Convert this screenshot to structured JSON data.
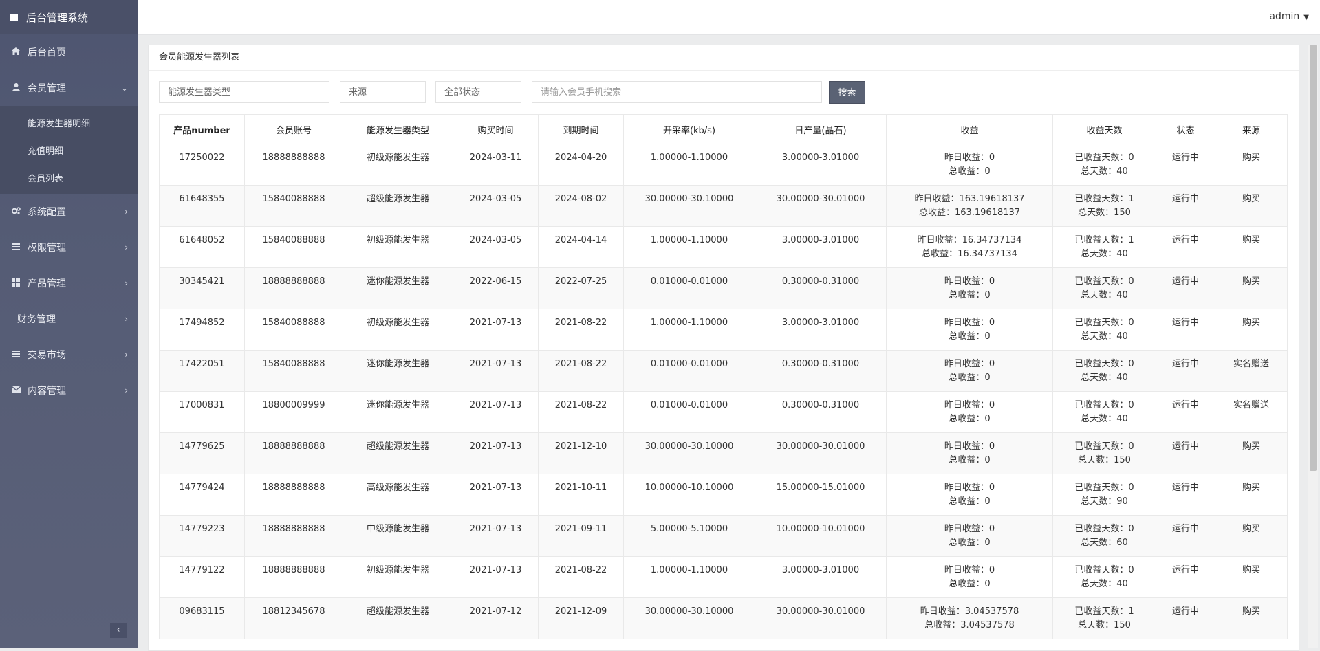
{
  "app": {
    "title": "后台管理系统"
  },
  "topbar": {
    "user": "admin"
  },
  "sidebar": {
    "items": [
      {
        "label": "后台首页",
        "icon": "home-icon"
      },
      {
        "label": "会员管理",
        "icon": "user-icon",
        "expanded": true
      },
      {
        "label": "系统配置",
        "icon": "gears-icon"
      },
      {
        "label": "权限管理",
        "icon": "list-icon"
      },
      {
        "label": "产品管理",
        "icon": "windows-icon"
      },
      {
        "label": "财务管理",
        "icon": ""
      },
      {
        "label": "交易市场",
        "icon": "bars-icon"
      },
      {
        "label": "内容管理",
        "icon": "envelope-icon"
      }
    ],
    "subitems": [
      "能源发生器明细",
      "充值明细",
      "会员列表"
    ]
  },
  "panel": {
    "title": "会员能源发生器列表"
  },
  "filters": {
    "type": "能源发生器类型",
    "source": "来源",
    "status": "全部状态",
    "search_placeholder": "请输入会员手机搜索",
    "search_button": "搜索"
  },
  "table": {
    "headers": [
      "产品number",
      "会员账号",
      "能源发生器类型",
      "购买时间",
      "到期时间",
      "开采率(kb/s)",
      "日产量(晶石)",
      "收益",
      "收益天数",
      "状态",
      "来源"
    ],
    "rows": [
      {
        "id": "17250022",
        "account": "18888888888",
        "type": "初级源能发生器",
        "buy": "2024-03-11",
        "expire": "2024-04-20",
        "rate": "1.00000-1.10000",
        "output": "3.00000-3.01000",
        "yesterday": "昨日收益：0",
        "total": "总收益：0",
        "days_done": "已收益天数：0",
        "days_total": "总天数：40",
        "status": "运行中",
        "source": "购买"
      },
      {
        "id": "61648355",
        "account": "15840088888",
        "type": "超级能源发生器",
        "buy": "2024-03-05",
        "expire": "2024-08-02",
        "rate": "30.00000-30.10000",
        "output": "30.00000-30.01000",
        "yesterday": "昨日收益：163.19618137",
        "total": "总收益：163.19618137",
        "days_done": "已收益天数：1",
        "days_total": "总天数：150",
        "status": "运行中",
        "source": "购买"
      },
      {
        "id": "61648052",
        "account": "15840088888",
        "type": "初级源能发生器",
        "buy": "2024-03-05",
        "expire": "2024-04-14",
        "rate": "1.00000-1.10000",
        "output": "3.00000-3.01000",
        "yesterday": "昨日收益：16.34737134",
        "total": "总收益：16.34737134",
        "days_done": "已收益天数：1",
        "days_total": "总天数：40",
        "status": "运行中",
        "source": "购买"
      },
      {
        "id": "30345421",
        "account": "18888888888",
        "type": "迷你能源发生器",
        "buy": "2022-06-15",
        "expire": "2022-07-25",
        "rate": "0.01000-0.01000",
        "output": "0.30000-0.31000",
        "yesterday": "昨日收益：0",
        "total": "总收益：0",
        "days_done": "已收益天数：0",
        "days_total": "总天数：40",
        "status": "运行中",
        "source": "购买"
      },
      {
        "id": "17494852",
        "account": "15840088888",
        "type": "初级源能发生器",
        "buy": "2021-07-13",
        "expire": "2021-08-22",
        "rate": "1.00000-1.10000",
        "output": "3.00000-3.01000",
        "yesterday": "昨日收益：0",
        "total": "总收益：0",
        "days_done": "已收益天数：0",
        "days_total": "总天数：40",
        "status": "运行中",
        "source": "购买"
      },
      {
        "id": "17422051",
        "account": "15840088888",
        "type": "迷你能源发生器",
        "buy": "2021-07-13",
        "expire": "2021-08-22",
        "rate": "0.01000-0.01000",
        "output": "0.30000-0.31000",
        "yesterday": "昨日收益：0",
        "total": "总收益：0",
        "days_done": "已收益天数：0",
        "days_total": "总天数：40",
        "status": "运行中",
        "source": "实名赠送"
      },
      {
        "id": "17000831",
        "account": "18800009999",
        "type": "迷你能源发生器",
        "buy": "2021-07-13",
        "expire": "2021-08-22",
        "rate": "0.01000-0.01000",
        "output": "0.30000-0.31000",
        "yesterday": "昨日收益：0",
        "total": "总收益：0",
        "days_done": "已收益天数：0",
        "days_total": "总天数：40",
        "status": "运行中",
        "source": "实名赠送"
      },
      {
        "id": "14779625",
        "account": "18888888888",
        "type": "超级能源发生器",
        "buy": "2021-07-13",
        "expire": "2021-12-10",
        "rate": "30.00000-30.10000",
        "output": "30.00000-30.01000",
        "yesterday": "昨日收益：0",
        "total": "总收益：0",
        "days_done": "已收益天数：0",
        "days_total": "总天数：150",
        "status": "运行中",
        "source": "购买"
      },
      {
        "id": "14779424",
        "account": "18888888888",
        "type": "高级源能发生器",
        "buy": "2021-07-13",
        "expire": "2021-10-11",
        "rate": "10.00000-10.10000",
        "output": "15.00000-15.01000",
        "yesterday": "昨日收益：0",
        "total": "总收益：0",
        "days_done": "已收益天数：0",
        "days_total": "总天数：90",
        "status": "运行中",
        "source": "购买"
      },
      {
        "id": "14779223",
        "account": "18888888888",
        "type": "中级源能发生器",
        "buy": "2021-07-13",
        "expire": "2021-09-11",
        "rate": "5.00000-5.10000",
        "output": "10.00000-10.01000",
        "yesterday": "昨日收益：0",
        "total": "总收益：0",
        "days_done": "已收益天数：0",
        "days_total": "总天数：60",
        "status": "运行中",
        "source": "购买"
      },
      {
        "id": "14779122",
        "account": "18888888888",
        "type": "初级源能发生器",
        "buy": "2021-07-13",
        "expire": "2021-08-22",
        "rate": "1.00000-1.10000",
        "output": "3.00000-3.01000",
        "yesterday": "昨日收益：0",
        "total": "总收益：0",
        "days_done": "已收益天数：0",
        "days_total": "总天数：40",
        "status": "运行中",
        "source": "购买"
      },
      {
        "id": "09683115",
        "account": "18812345678",
        "type": "超级能源发生器",
        "buy": "2021-07-12",
        "expire": "2021-12-09",
        "rate": "30.00000-30.10000",
        "output": "30.00000-30.01000",
        "yesterday": "昨日收益：3.04537578",
        "total": "总收益：3.04537578",
        "days_done": "已收益天数：1",
        "days_total": "总天数：150",
        "status": "运行中",
        "source": "购买"
      }
    ]
  }
}
